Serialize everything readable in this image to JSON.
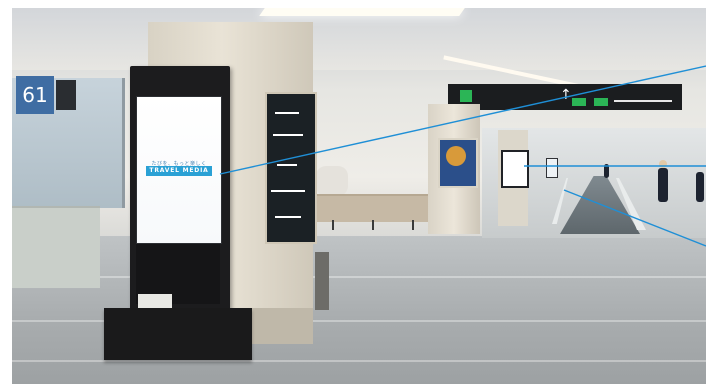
{
  "scene": {
    "gate_sign": {
      "number": "61",
      "color": "#3f6da3"
    },
    "kiosk": {
      "brand_small": "たびを、もっと楽しく",
      "brand_main": "TRAVEL MEDIA",
      "brand_color": "#2aa1d5"
    },
    "annotation_color": "#1f8fd6",
    "overhead_sign_colors": {
      "background": "#1b1d1f",
      "accent": "#2bb556"
    }
  }
}
